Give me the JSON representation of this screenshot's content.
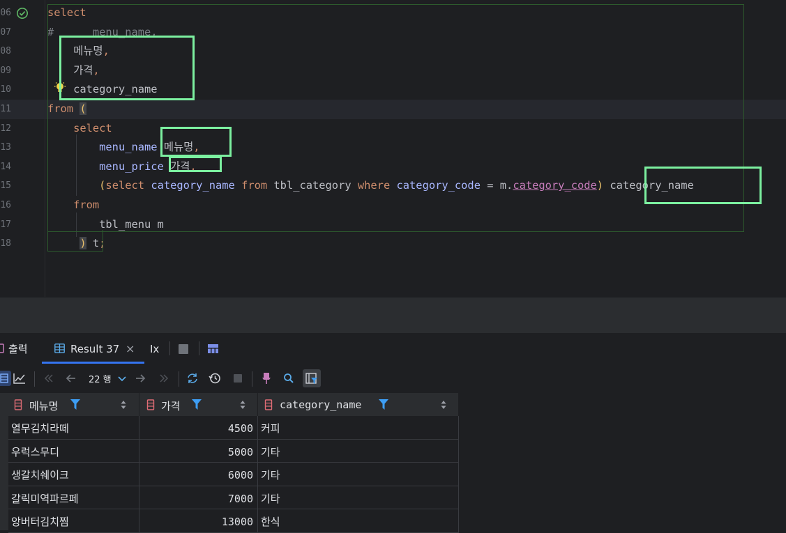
{
  "editor": {
    "line_numbers": [
      "06",
      "07",
      "08",
      "09",
      "10",
      "11",
      "12",
      "13",
      "14",
      "15",
      "16",
      "17",
      "18"
    ],
    "lines": [
      [
        {
          "t": "select",
          "c": "kw"
        }
      ],
      [
        {
          "t": "#      menu_name,",
          "c": "cm"
        }
      ],
      [
        {
          "t": "    "
        },
        {
          "t": "메뉴명",
          "c": ""
        },
        {
          "t": ",",
          "c": "kw"
        }
      ],
      [
        {
          "t": "    "
        },
        {
          "t": "가격",
          "c": ""
        },
        {
          "t": ",",
          "c": "kw"
        }
      ],
      [
        {
          "t": "    category_name",
          "c": ""
        }
      ],
      [
        {
          "t": "from",
          "c": "kw"
        },
        {
          "t": " "
        },
        {
          "t": "(",
          "c": "hl-paren"
        }
      ],
      [
        {
          "t": "    "
        },
        {
          "t": "select",
          "c": "kw"
        }
      ],
      [
        {
          "t": "        "
        },
        {
          "t": "menu_name",
          "c": "col"
        },
        {
          "t": " 메뉴명"
        },
        {
          "t": ",",
          "c": "kw"
        }
      ],
      [
        {
          "t": "        "
        },
        {
          "t": "menu_price",
          "c": "col"
        },
        {
          "t": " 가격"
        },
        {
          "t": ",",
          "c": "kw"
        }
      ],
      [
        {
          "t": "        "
        },
        {
          "t": "(",
          "c": "paren"
        },
        {
          "t": "select",
          "c": "kw"
        },
        {
          "t": " "
        },
        {
          "t": "category_name",
          "c": "col"
        },
        {
          "t": " "
        },
        {
          "t": "from",
          "c": "kw"
        },
        {
          "t": " tbl_category "
        },
        {
          "t": "where",
          "c": "kw"
        },
        {
          "t": " "
        },
        {
          "t": "category_code",
          "c": "col"
        },
        {
          "t": " = m."
        },
        {
          "t": "category_code",
          "c": "link"
        },
        {
          "t": ")",
          "c": "paren"
        },
        {
          "t": " category_name"
        }
      ],
      [
        {
          "t": "    "
        },
        {
          "t": "from",
          "c": "kw"
        }
      ],
      [
        {
          "t": "        tbl_menu m"
        }
      ],
      [
        {
          "t": "     "
        },
        {
          "t": ")",
          "c": "hl-paren"
        },
        {
          "t": " t"
        },
        {
          "t": ";",
          "c": "kw"
        }
      ]
    ],
    "current_line_index": 5
  },
  "tabs": {
    "output_label": "출력",
    "result_label": "Result 37",
    "close_glyph": "×",
    "tx_label": "Ix"
  },
  "toolbar": {
    "rows_label": "22 행",
    "icons": [
      "table-view-icon",
      "chart-icon",
      "first-page-icon",
      "prev-page-icon",
      "rows-dropdown-icon",
      "next-page-icon",
      "last-page-icon",
      "refresh-icon",
      "history-icon",
      "stop-icon",
      "pin-icon",
      "search-icon",
      "filter-view-icon"
    ]
  },
  "grid": {
    "columns": [
      {
        "label": "메뉴명"
      },
      {
        "label": "가격"
      },
      {
        "label": "category_name"
      }
    ],
    "rows": [
      [
        "열무김치라떼",
        "4500",
        "커피"
      ],
      [
        "우럭스무디",
        "5000",
        "기타"
      ],
      [
        "생갈치쉐이크",
        "6000",
        "기타"
      ],
      [
        "갈릭미역파르페",
        "7000",
        "기타"
      ],
      [
        "앙버터김치찜",
        "13000",
        "한식"
      ]
    ]
  },
  "colors": {
    "accent": "#3574f0",
    "annotation_box": "#7cf0a0",
    "keyword": "#cf8e6d",
    "column": "#a9b7ff",
    "filter": "#3d9ef5",
    "db_column": "#e06c75"
  }
}
